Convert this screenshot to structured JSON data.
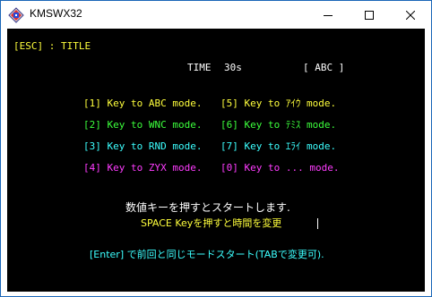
{
  "window": {
    "title": "KMSWX32",
    "icons": {
      "app": "app-logo-icon",
      "minimize": "minimize-icon",
      "maximize": "maximize-icon",
      "close": "close-icon"
    }
  },
  "colors": {
    "yellow": "#ffff3c",
    "green": "#3cff3c",
    "cyan": "#3cffff",
    "magenta": "#ff3cff",
    "white": "#ffffff",
    "background": "#000000"
  },
  "screen": {
    "esc_title": "[ESC] : TITLE",
    "time_label": "TIME",
    "time_value": "30s",
    "mode_indicator": "[ ABC ]",
    "modes": [
      {
        "text": "[1] Key to ABC mode."
      },
      {
        "text": "[2] Key to WNC mode."
      },
      {
        "text": "[3] Key to RND mode."
      },
      {
        "text": "[4] Key to ZYX mode."
      },
      {
        "text": "[5] Key to ｱｲｳ mode."
      },
      {
        "text": "[6] Key to ﾃﾐｽ mode."
      },
      {
        "text": "[7] Key to ｴﾗｲ mode."
      },
      {
        "text": "[0] Key to ... mode."
      }
    ],
    "start_message": "数値キーを押すとスタートします.",
    "space_hint": "SPACE Keyを押すと時間を変更",
    "enter_hint": "[Enter] で前回と同じモードスタート(TABで変更可)."
  }
}
